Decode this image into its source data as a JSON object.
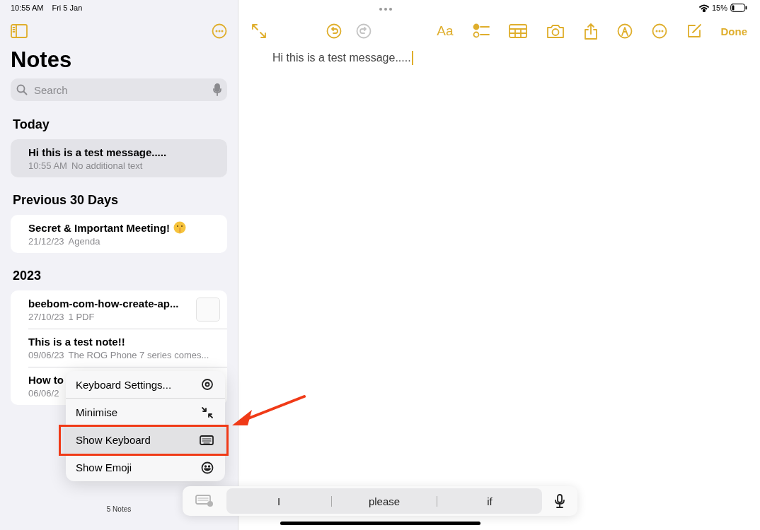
{
  "status_bar": {
    "time": "10:55 AM",
    "date": "Fri 5 Jan",
    "battery": "15%"
  },
  "sidebar": {
    "title": "Notes",
    "search": {
      "placeholder": "Search"
    },
    "sections": [
      {
        "heading": "Today",
        "notes": [
          {
            "kind": "text",
            "title": "Hi this is a test message.....",
            "date": "10:55 AM",
            "preview": "No additional text",
            "selected": true
          }
        ]
      },
      {
        "heading": "Previous 30 Days",
        "notes": [
          {
            "kind": "emoji",
            "title": "Secret & Important Meeting!",
            "date": "21/12/23",
            "preview": "Agenda",
            "selected": false
          }
        ]
      },
      {
        "heading": "2023",
        "notes": [
          {
            "kind": "pdf",
            "title": "beebom-com-how-create-ap...",
            "date": "27/10/23",
            "preview": "1 PDF",
            "selected": false
          },
          {
            "kind": "text",
            "title": "This is a test note!!",
            "date": "09/06/23",
            "preview": "The ROG Phone 7 series comes...",
            "selected": false
          },
          {
            "kind": "text",
            "title": "How to",
            "date": "06/06/2",
            "selected": false
          }
        ]
      }
    ],
    "footer": "5 Notes"
  },
  "editor": {
    "undo": {
      "disabled": false
    },
    "redo": {
      "disabled": true
    },
    "format_label": "Aa",
    "done_label": "Done",
    "body": "Hi this is a test message....."
  },
  "context_menu": {
    "items": [
      {
        "kind": "settings",
        "label": "Keyboard Settings...",
        "selected": false
      },
      {
        "kind": "minimise",
        "label": "Minimise",
        "selected": false
      },
      {
        "kind": "keyboard",
        "label": "Show Keyboard",
        "selected": true
      },
      {
        "kind": "emoji",
        "label": "Show Emoji",
        "selected": false
      }
    ]
  },
  "keyboard_bar": {
    "suggestions": [
      "I",
      "please",
      "if"
    ]
  }
}
